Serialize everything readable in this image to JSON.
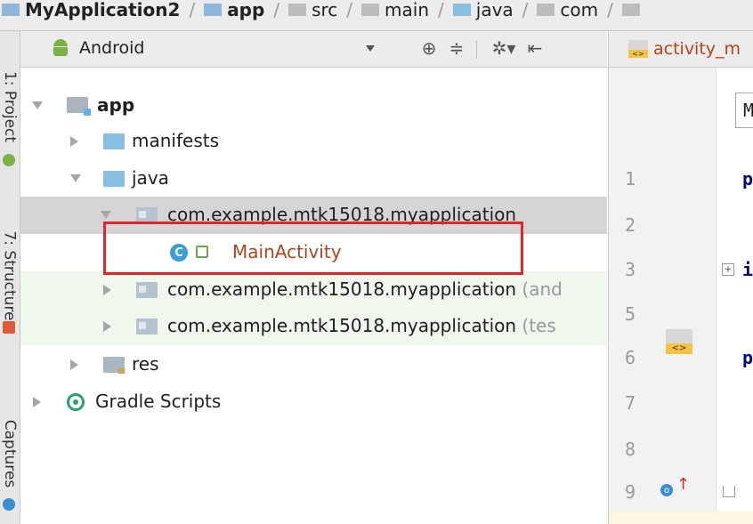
{
  "breadcrumb": {
    "items": [
      "MyApplication2",
      "app",
      "src",
      "main",
      "java",
      "com"
    ]
  },
  "tool_window_tabs": [
    "1: Project",
    "7: Structure",
    "Captures"
  ],
  "project_panel": {
    "view_mode": "Android"
  },
  "tree": {
    "app": "app",
    "manifests": "manifests",
    "java": "java",
    "package_main": "com.example.mtk15018.myapplication",
    "main_activity": "MainActivity",
    "package_android_test": "com.example.mtk15018.myapplication",
    "package_android_test_suffix": "(and",
    "package_test": "com.example.mtk15018.myapplication",
    "package_test_suffix": "(tes",
    "res": "res",
    "gradle_scripts": "Gradle Scripts",
    "class_icon_letter": "C"
  },
  "editor": {
    "tab_label": "activity_m",
    "crumb_char": "M",
    "line_numbers": [
      "1",
      "2",
      "3",
      "5",
      "6",
      "7",
      "8",
      "9"
    ],
    "code_chars": {
      "line1": "p",
      "line3": "i",
      "line6": "p"
    },
    "xml_icon_text": "<>",
    "override_letter": "o"
  },
  "colors": {
    "highlight_box": "#e0262b",
    "selected_row": "#d5d5d5",
    "test_rows_bg": "#f0f7ec",
    "activity_text": "#b5421a"
  }
}
